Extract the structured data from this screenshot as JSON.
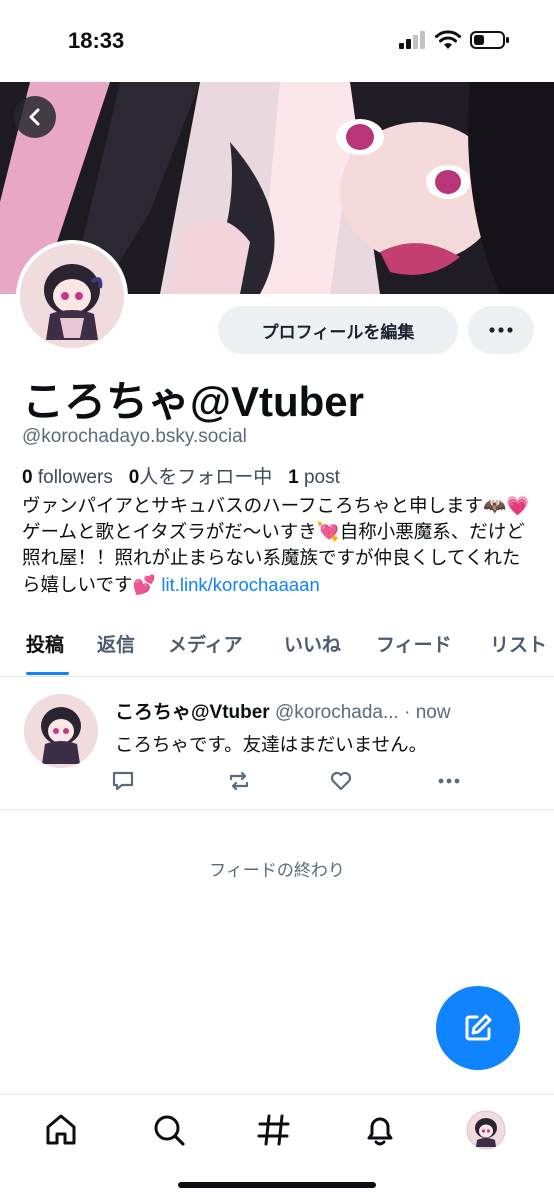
{
  "status_bar": {
    "time": "18:33"
  },
  "profile": {
    "display_name": "ころちゃ@Vtuber",
    "handle": "@korochadayo.bsky.social",
    "edit_button": "プロフィールを編集",
    "followers_count": "0",
    "followers_label": "followers",
    "following_count": "0",
    "following_label": "人をフォロー中",
    "posts_count": "1",
    "posts_label": "post",
    "bio_text": "ヴァンパイアとサキュバスのハーフころちゃと申します🦇💗ゲームと歌とイタズラがだ〜いすき💘自称小悪魔系、だけど照れ屋！！照れが止まらない系魔族ですが仲良くしてくれたら嬉しいです💕 ",
    "bio_link": "lit.link/korochaaaan"
  },
  "tabs": [
    {
      "label": "投稿",
      "active": true
    },
    {
      "label": "返信"
    },
    {
      "label": "メディア"
    },
    {
      "label": "いいね"
    },
    {
      "label": "フィード"
    },
    {
      "label": "リスト"
    }
  ],
  "post": {
    "author": "ころちゃ@Vtuber",
    "handle": "@korochada...",
    "time": "· now",
    "text": "ころちゃです。友達はまだいません。"
  },
  "feed_end": "フィードの終わり",
  "icons": {
    "back": "chevron-left-icon",
    "more": "ellipsis-icon",
    "reply": "comment-icon",
    "repost": "repost-icon",
    "like": "heart-icon",
    "compose": "compose-icon",
    "nav": [
      "home-icon",
      "search-icon",
      "hashtag-icon",
      "bell-icon",
      "profile-avatar"
    ]
  },
  "colors": {
    "accent": "#1083fe",
    "muted": "#5b6b7c"
  }
}
